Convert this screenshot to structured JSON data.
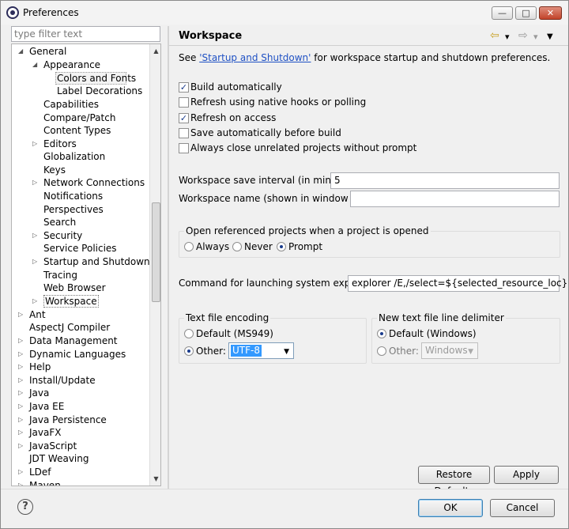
{
  "window": {
    "title": "Preferences",
    "min_glyph": "—",
    "max_glyph": "□",
    "close_glyph": "✕"
  },
  "filter": {
    "placeholder": "type filter text"
  },
  "tree": {
    "items": [
      {
        "label": "General",
        "expanded": true
      },
      {
        "label": "Appearance",
        "expanded": true
      },
      {
        "label": "Colors and Fonts"
      },
      {
        "label": "Label Decorations"
      },
      {
        "label": "Capabilities"
      },
      {
        "label": "Compare/Patch"
      },
      {
        "label": "Content Types"
      },
      {
        "label": "Editors",
        "expandable": true
      },
      {
        "label": "Globalization"
      },
      {
        "label": "Keys"
      },
      {
        "label": "Network Connections",
        "expandable": true
      },
      {
        "label": "Notifications"
      },
      {
        "label": "Perspectives"
      },
      {
        "label": "Search"
      },
      {
        "label": "Security",
        "expandable": true
      },
      {
        "label": "Service Policies"
      },
      {
        "label": "Startup and Shutdown",
        "expandable": true
      },
      {
        "label": "Tracing"
      },
      {
        "label": "Web Browser"
      },
      {
        "label": "Workspace",
        "expandable": true
      },
      {
        "label": "Ant",
        "expandable": true
      },
      {
        "label": "AspectJ Compiler"
      },
      {
        "label": "Data Management",
        "expandable": true
      },
      {
        "label": "Dynamic Languages",
        "expandable": true
      },
      {
        "label": "Help",
        "expandable": true
      },
      {
        "label": "Install/Update",
        "expandable": true
      },
      {
        "label": "Java",
        "expandable": true
      },
      {
        "label": "Java EE",
        "expandable": true
      },
      {
        "label": "Java Persistence",
        "expandable": true
      },
      {
        "label": "JavaFX",
        "expandable": true
      },
      {
        "label": "JavaScript",
        "expandable": true
      },
      {
        "label": "JDT Weaving"
      },
      {
        "label": "LDef",
        "expandable": true
      },
      {
        "label": "Maven",
        "expandable": true
      }
    ]
  },
  "page": {
    "title": "Workspace",
    "see_prefix": "See ",
    "see_link": "'Startup and Shutdown'",
    "see_suffix": " for workspace startup and shutdown preferences.",
    "checkboxes": [
      {
        "label": "Build automatically",
        "checked": true
      },
      {
        "label": "Refresh using native hooks or polling",
        "checked": false
      },
      {
        "label": "Refresh on access",
        "checked": true
      },
      {
        "label": "Save automatically before build",
        "checked": false
      },
      {
        "label": "Always close unrelated projects without prompt",
        "checked": false
      }
    ],
    "save_interval_label": "Workspace save interval (in minutes):",
    "save_interval_value": "5",
    "workspace_name_label": "Workspace name (shown in window title):",
    "workspace_name_value": "",
    "open_ref_group": {
      "title": "Open referenced projects when a project is opened",
      "options": [
        "Always",
        "Never",
        "Prompt"
      ],
      "selected": "Prompt"
    },
    "explorer_label": "Command for launching system explorer:",
    "explorer_value": "explorer /E,/select=${selected_resource_loc}",
    "encoding_group": {
      "title": "Text file encoding",
      "default_label": "Default (MS949)",
      "other_label": "Other:",
      "other_value": "UTF-8",
      "selected": "Other"
    },
    "delimiter_group": {
      "title": "New text file line delimiter",
      "default_label": "Default (Windows)",
      "other_label": "Other:",
      "other_value": "Windows",
      "selected": "Default"
    },
    "restore_defaults": "Restore Defaults",
    "apply": "Apply"
  },
  "footer": {
    "help_glyph": "?",
    "ok": "OK",
    "cancel": "Cancel"
  },
  "nav_icons": {
    "back": "⇦",
    "forward": "⇨",
    "dropdown": "▾",
    "menu": "▼"
  },
  "glyphs": {
    "check": "✓",
    "combo_arrow": "▼",
    "scroll_up": "▲",
    "scroll_down": "▼",
    "tree_expanded": "◢",
    "tree_collapsed": "▷"
  }
}
